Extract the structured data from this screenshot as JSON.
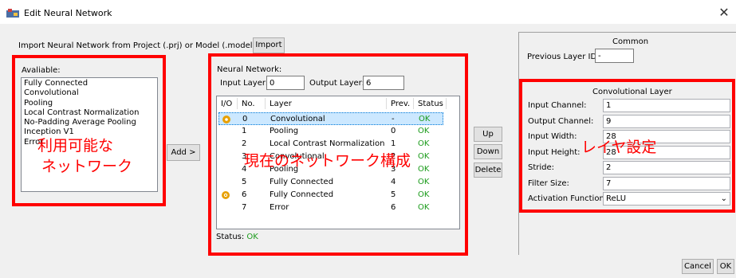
{
  "window": {
    "title": "Edit Neural Network"
  },
  "import": {
    "label": "Import Neural Network from Project (.prj) or Model (.model) File:",
    "button": "Import"
  },
  "available": {
    "label": "Avaliable:",
    "items": [
      "Fully Connected",
      "Convolutional",
      "Pooling",
      "Local Contrast Normalization",
      "No-Padding Average Pooling",
      "Inception V1",
      "Error"
    ],
    "add_button": "Add >"
  },
  "network": {
    "label": "Neural Network:",
    "input_layer_label": "Input Layer:",
    "input_layer_value": "0",
    "output_layer_label": "Output Layer:",
    "output_layer_value": "6",
    "columns": [
      "I/O",
      "No.",
      "Layer",
      "Prev.",
      "Status"
    ],
    "rows": [
      {
        "no": "0",
        "layer": "Convolutional",
        "prev": "-",
        "status": "OK"
      },
      {
        "no": "1",
        "layer": "Pooling",
        "prev": "0",
        "status": "OK"
      },
      {
        "no": "2",
        "layer": "Local Contrast Normalization",
        "prev": "1",
        "status": "OK"
      },
      {
        "no": "3",
        "layer": "Convolutional",
        "prev": "2",
        "status": "OK"
      },
      {
        "no": "4",
        "layer": "Pooling",
        "prev": "3",
        "status": "OK"
      },
      {
        "no": "5",
        "layer": "Fully Connected",
        "prev": "4",
        "status": "OK"
      },
      {
        "no": "6",
        "layer": "Fully Connected",
        "prev": "5",
        "status": "OK"
      },
      {
        "no": "7",
        "layer": "Error",
        "prev": "6",
        "status": "OK"
      }
    ],
    "status_label": "Status:",
    "status_value": "OK"
  },
  "actions": {
    "up": "Up",
    "down": "Down",
    "delete": "Delete"
  },
  "common": {
    "title": "Common",
    "prev_layer_label": "Previous Layer ID:",
    "prev_layer_value": "-"
  },
  "conv": {
    "title": "Convolutional Layer",
    "fields": [
      {
        "label": "Input Channel:",
        "value": "1"
      },
      {
        "label": "Output Channel:",
        "value": "9"
      },
      {
        "label": "Input Width:",
        "value": "28"
      },
      {
        "label": "Input Height:",
        "value": "28"
      },
      {
        "label": "Stride:",
        "value": "2"
      },
      {
        "label": "Filter Size:",
        "value": "7"
      },
      {
        "label": "Activation Function:",
        "value": "ReLU"
      }
    ]
  },
  "annotations": {
    "available_line1": "利用可能な",
    "available_line2": "ネットワーク",
    "network": "現在のネットワーク構成",
    "layer": "レイヤ設定"
  },
  "footer": {
    "cancel": "Cancel",
    "ok": "OK"
  },
  "colors": {
    "annotation": "#ff0000",
    "ok_status": "#1a9b1a",
    "selection": "#cce8ff",
    "io_marker": "#e8a000"
  }
}
